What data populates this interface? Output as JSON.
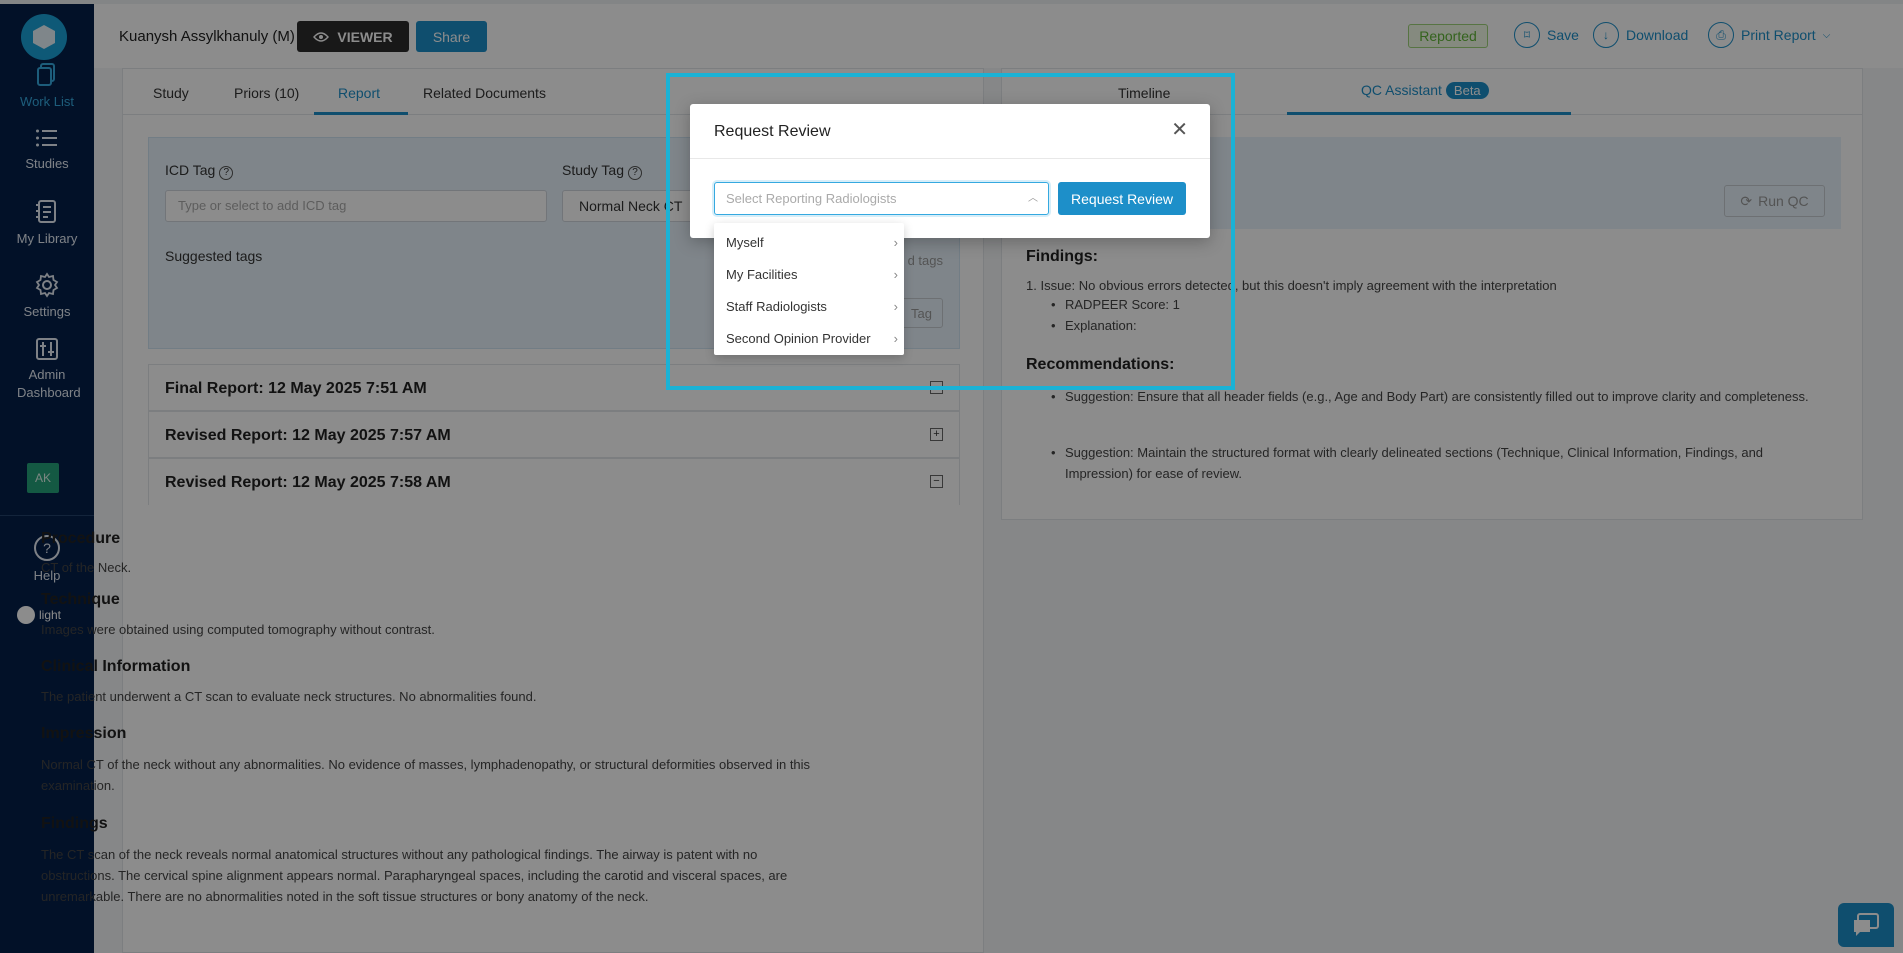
{
  "sidebar": {
    "items": [
      {
        "label": "Work List",
        "icon": "worklist-icon"
      },
      {
        "label": "Studies",
        "icon": "list-icon"
      },
      {
        "label": "My Library",
        "icon": "library-icon"
      },
      {
        "label": "Settings",
        "icon": "gear-icon"
      },
      {
        "label": "Admin Dashboard",
        "icon": "sliders-icon"
      }
    ],
    "avatar": "AK",
    "help": "Help",
    "theme": "light"
  },
  "header": {
    "patient": "Kuanysh Assylkhanuly (M)",
    "viewer": "VIEWER",
    "share": "Share",
    "status": "Reported",
    "save": "Save",
    "download": "Download",
    "print": "Print Report"
  },
  "left": {
    "tabs": [
      "Study",
      "Priors (10)",
      "Report",
      "Related Documents"
    ],
    "icd_label": "ICD Tag",
    "icd_placeholder": "Type or select to add ICD tag",
    "study_tag_label": "Study Tag",
    "study_tag_value": "Normal Neck CT",
    "suggested_label": "Suggested tags",
    "tag_partial": "d tags",
    "tag_btn_partial": "Tag",
    "reports": [
      {
        "title": "Final Report: 12 May 2025 7:51 AM",
        "toggle": "⊟"
      },
      {
        "title": "Revised Report: 12 May 2025 7:57 AM",
        "toggle": "+"
      },
      {
        "title": "Revised Report: 12 May 2025 7:58 AM",
        "toggle": "−"
      }
    ],
    "sections": {
      "procedure_h": "Procedure",
      "procedure": "CT of the Neck.",
      "technique_h": "Technique",
      "technique": "Images were obtained using computed tomography without contrast.",
      "clinical_h": "Clinical Information",
      "clinical": "The patient underwent a CT scan to evaluate neck structures. No abnormalities found.",
      "impression_h": "Impression",
      "impression": "Normal CT of the neck without any abnormalities. No evidence of masses, lymphadenopathy, or structural deformities observed in this examination.",
      "findings_h": "Findings",
      "findings": "The CT scan of the neck reveals normal anatomical structures without any pathological findings. The airway is patent with no obstructions. The cervical spine alignment appears normal. Parapharyngeal spaces, including the carotid and visceral spaces, are unremarkable. There are no abnormalities noted in the soft tissue structures or bony anatomy of the neck."
    }
  },
  "right": {
    "tab_timeline": "Timeline",
    "tab_qc": "QC Assistant",
    "beta": "Beta",
    "run_qc": "Run QC",
    "findings_h": "Findings:",
    "issue": "1. Issue: No obvious errors detected, but this doesn't imply agreement with the interpretation",
    "radpeer": "RADPEER Score: 1",
    "explanation": "Explanation:",
    "recommendations_h": "Recommendations:",
    "suggestion1": "Suggestion: Ensure that all header fields (e.g., Age and Body Part) are consistently filled out to improve clarity and completeness.",
    "suggestion2": "Suggestion: Maintain the structured format with clearly delineated sections (Technique, Clinical Information, Findings, and Impression) for ease of review."
  },
  "modal": {
    "title": "Request Review",
    "close": "✕",
    "placeholder": "Select Reporting Radiologists",
    "button": "Request Review",
    "options": [
      "Myself",
      "My Facilities",
      "Staff Radiologists",
      "Second Opinion Provider"
    ]
  },
  "colors": {
    "accent": "#1d8fc9",
    "sidebar": "#04204a",
    "highlight": "#1ab2d6",
    "reported": "#5fb536"
  }
}
